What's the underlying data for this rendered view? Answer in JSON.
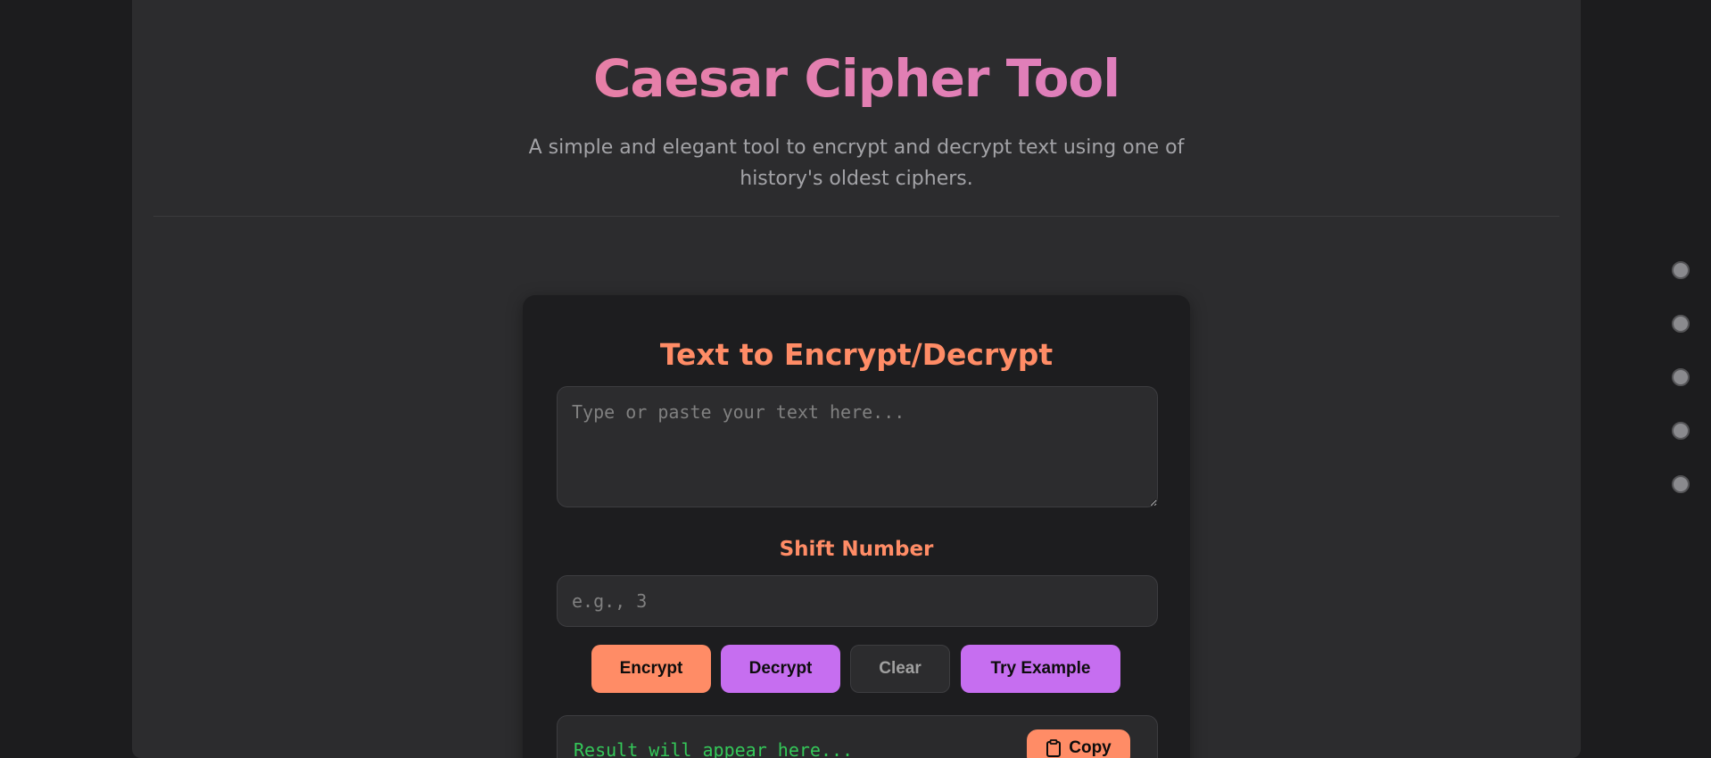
{
  "header": {
    "title": "Caesar Cipher Tool",
    "subtitle": "A simple and elegant tool to encrypt and decrypt text using one of history's oldest ciphers."
  },
  "card": {
    "heading": "Text to Encrypt/Decrypt",
    "text_input": {
      "value": "",
      "placeholder": "Type or paste your text here..."
    },
    "shift_label": "Shift Number",
    "shift_input": {
      "value": "",
      "placeholder": "e.g., 3"
    },
    "buttons": {
      "encrypt": "Encrypt",
      "decrypt": "Decrypt",
      "clear": "Clear",
      "example": "Try Example"
    },
    "result": {
      "placeholder_text": "Result will appear here...",
      "copy_label": "Copy",
      "copy_icon": "clipboard-icon"
    }
  },
  "side_nav": {
    "dots": [
      "section-1",
      "section-2",
      "section-3",
      "section-4",
      "section-5"
    ]
  },
  "colors": {
    "page_background": "#1c1c1e",
    "panel_background": "#2c2c2e",
    "card_background": "#1d1d1f",
    "accent_orange": "#ff8c66",
    "accent_purple": "#c66ef0",
    "title_gradient_start": "#ef7f93",
    "title_gradient_end": "#d77fd0",
    "result_text": "#34c759"
  }
}
